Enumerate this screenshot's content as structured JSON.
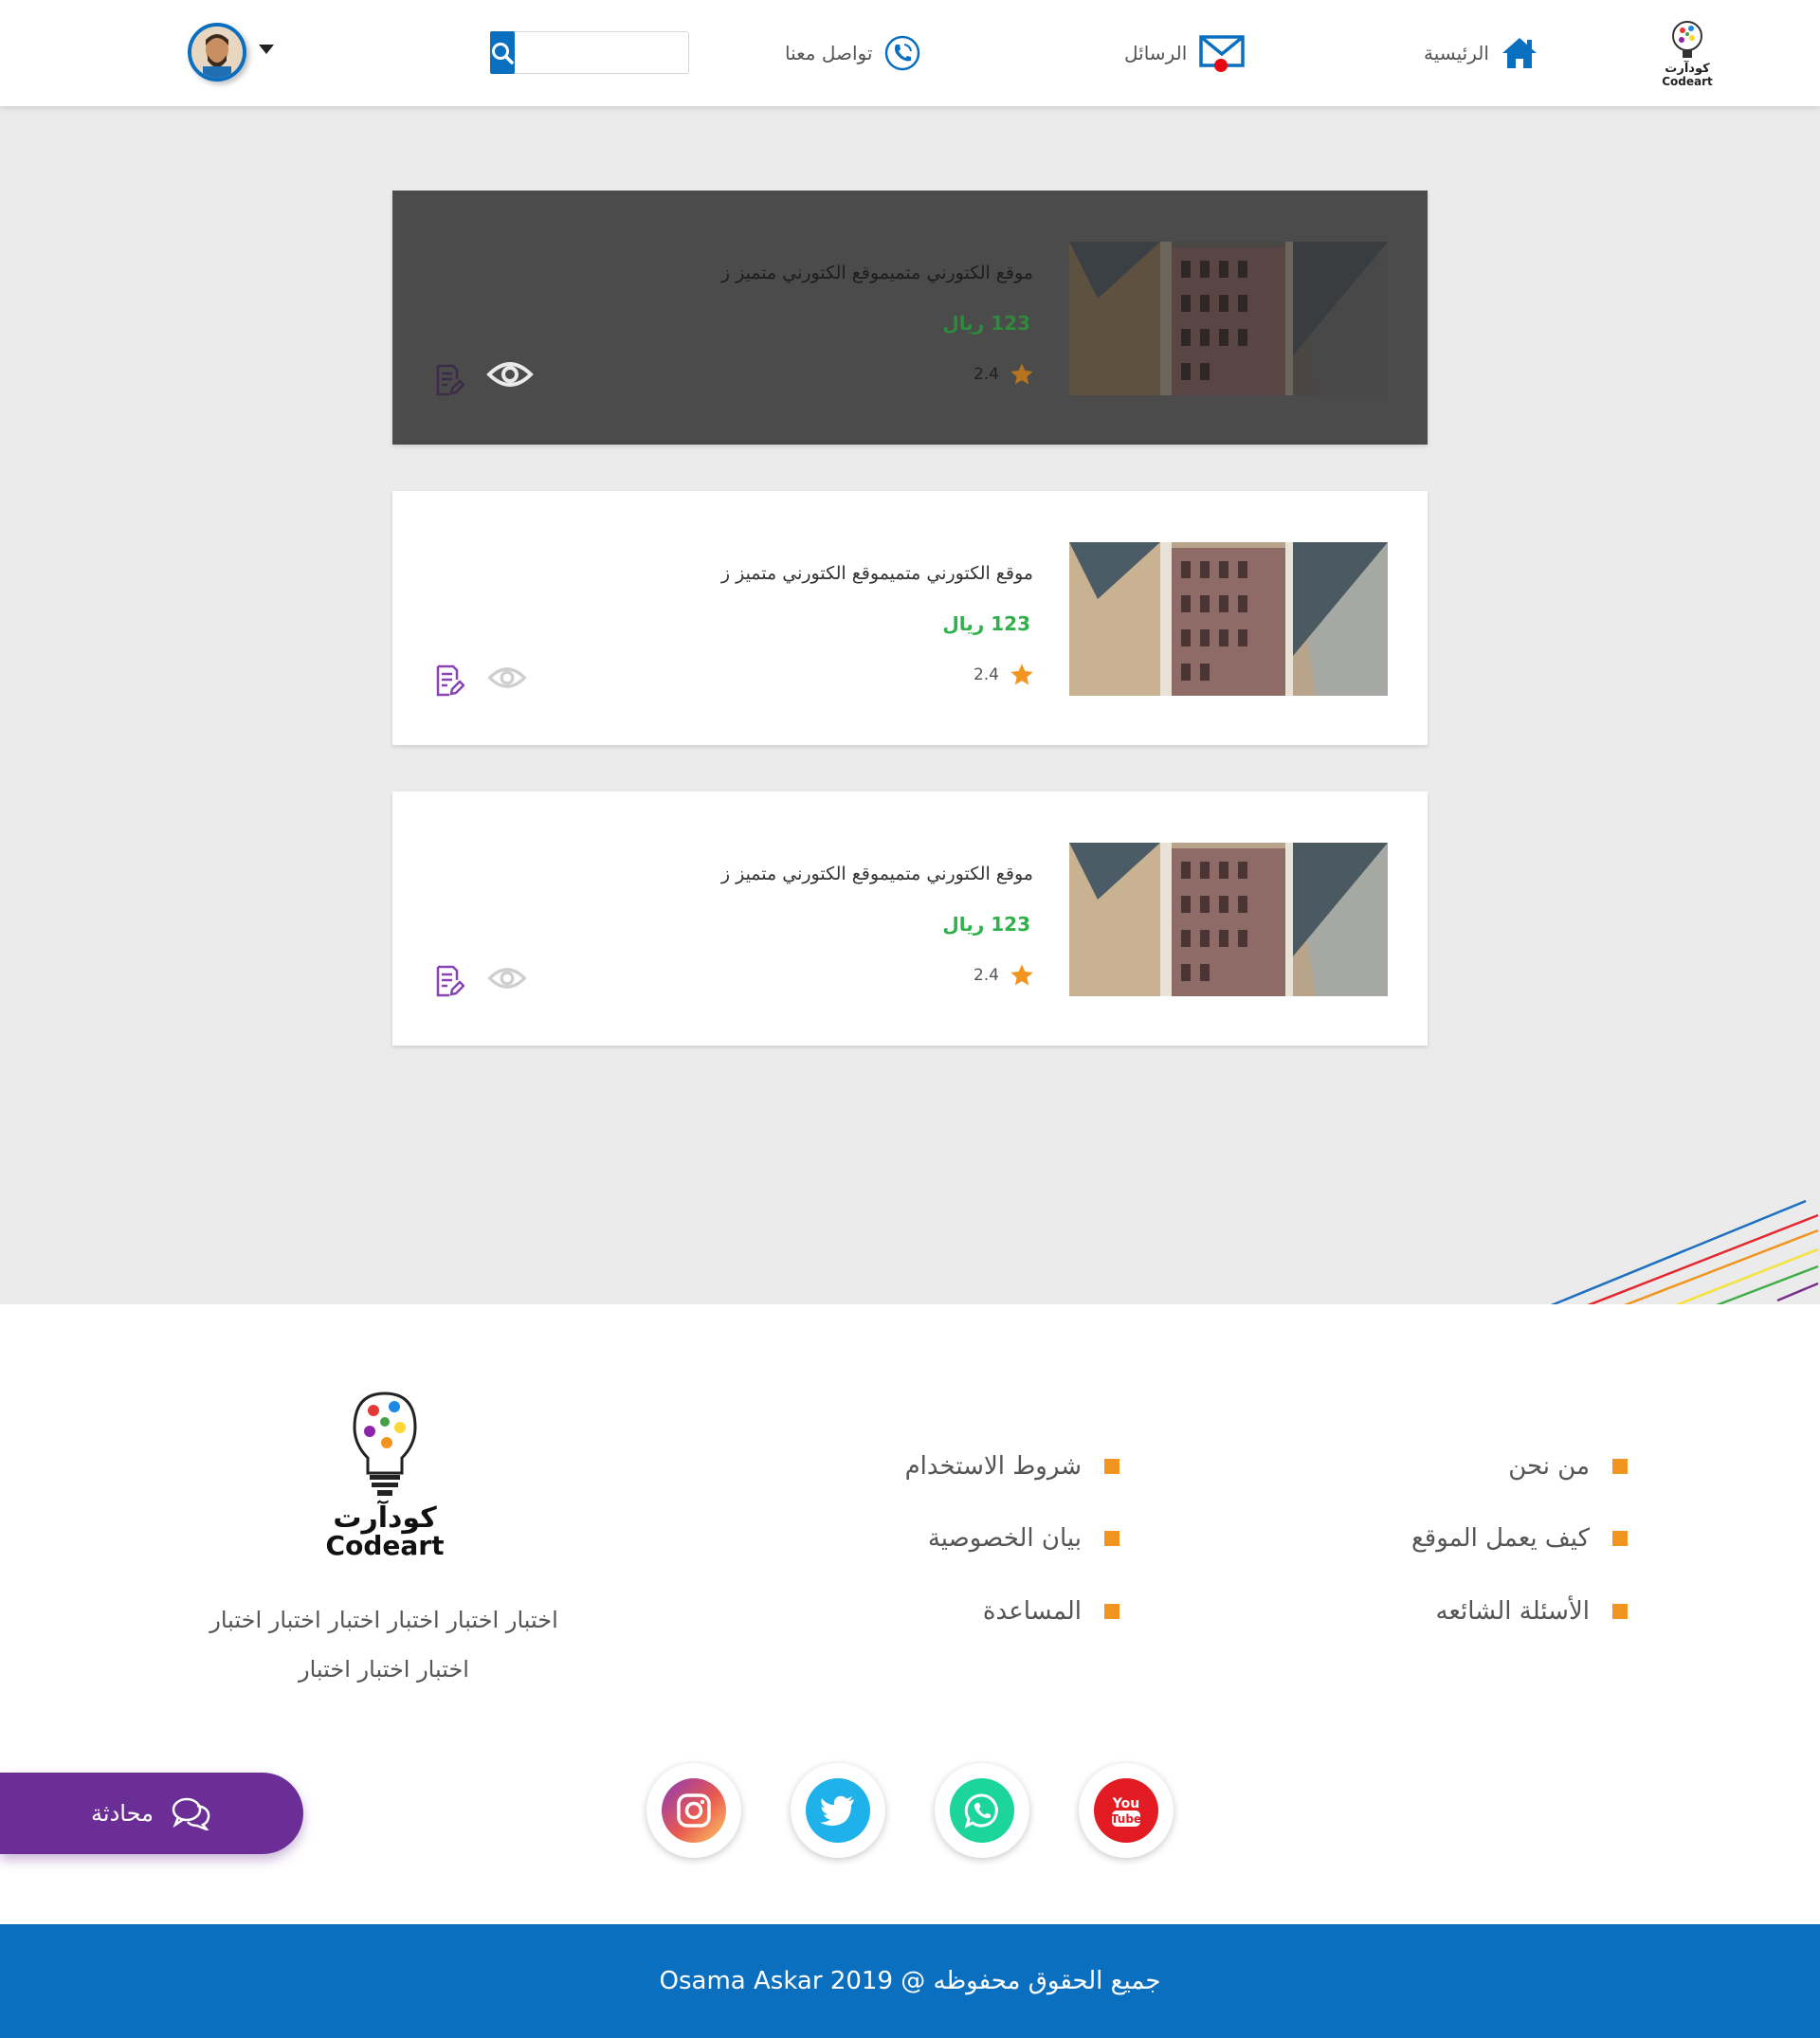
{
  "colors": {
    "primary": "#0b6fc0",
    "accent_orange": "#f2951e",
    "price_green": "#2fb04a",
    "chat_purple": "#6b2e96",
    "background_gray": "#ebebeb"
  },
  "header": {
    "logo_text_ar": "كودآرت",
    "logo_text_en": "Codeart",
    "nav": {
      "home": {
        "label": "الرئيسية",
        "icon": "home-icon"
      },
      "messages": {
        "label": "الرسائل",
        "icon": "mail-icon"
      },
      "contact": {
        "label": "تواصل معنا",
        "icon": "phone-icon"
      }
    },
    "search": {
      "placeholder": "",
      "value": "",
      "icon": "search-icon"
    },
    "user": {
      "avatar": "user-avatar",
      "menu_icon": "caret-down-icon"
    }
  },
  "cards": [
    {
      "title": "موقع الكتورني متميموقع الكتورني متميز ز",
      "price": "123 ريال",
      "rating": "2.4",
      "highlighted": true
    },
    {
      "title": "موقع الكتورني متميموقع الكتورني متميز ز",
      "price": "123 ريال",
      "rating": "2.4",
      "highlighted": false
    },
    {
      "title": "موقع الكتورني متميموقع الكتورني متميز ز",
      "price": "123 ريال",
      "rating": "2.4",
      "highlighted": false
    }
  ],
  "footer": {
    "links_col1": [
      "من نحن",
      "كيف يعمل الموقع",
      "الأسئلة الشائعه"
    ],
    "links_col2": [
      "شروط الاستخدام",
      "بيان الخصوصية",
      "المساعدة"
    ],
    "logo_text_ar": "كودآرت",
    "logo_text_en": "Codeart",
    "description_line1": "اختبار اختبار اختبار اختبار اختبار اختبار",
    "description_line2": "اختبار اختبار اختبار",
    "social": [
      {
        "name": "instagram",
        "icon": "instagram-icon"
      },
      {
        "name": "twitter",
        "icon": "twitter-icon"
      },
      {
        "name": "whatsapp",
        "icon": "whatsapp-icon"
      },
      {
        "name": "youtube",
        "icon": "youtube-icon",
        "label_top": "You",
        "label_bottom": "Tube"
      }
    ],
    "chat_label": "محادثة",
    "copyright": "جميع الحقوق محفوظه @ 2019 Osama Askar"
  }
}
